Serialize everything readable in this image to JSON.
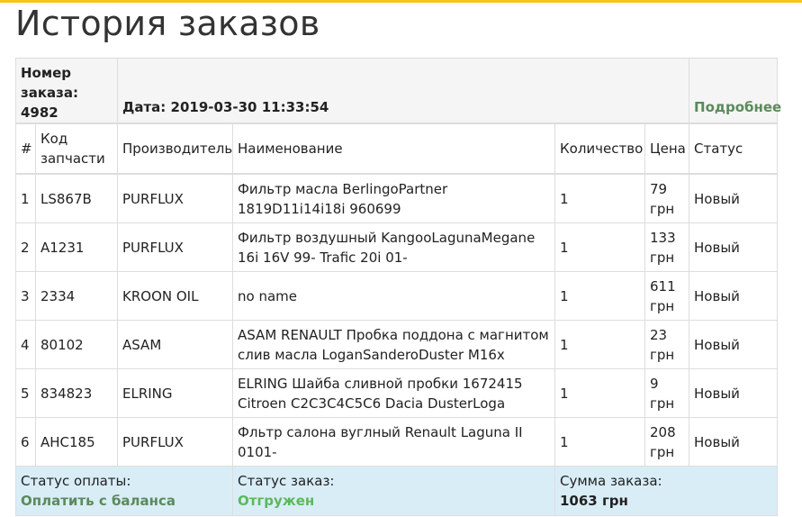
{
  "page_title": "История заказов",
  "order": {
    "number_label": "Номер заказа:",
    "number": "4982",
    "date_label": "Дата:",
    "date": "2019-03-30 11:33:54",
    "details_link": "Подробнее"
  },
  "columns": [
    "#",
    "Код запчасти",
    "Производитель",
    "Наименование",
    "Количество",
    "Цена",
    "Статус"
  ],
  "items": [
    {
      "n": "1",
      "code": "LS867B",
      "maker": "PURFLUX",
      "name": "Фильтр масла BerlingoPartner 1819D11i14i18i 960699",
      "qty": "1",
      "price": "79 грн",
      "status": "Новый"
    },
    {
      "n": "2",
      "code": "A1231",
      "maker": "PURFLUX",
      "name": "Фильтр воздушный KangooLagunaMegane 16i 16V 99- Trafic 20i 01-",
      "qty": "1",
      "price": "133 грн",
      "status": "Новый"
    },
    {
      "n": "3",
      "code": "2334",
      "maker": "KROON OIL",
      "name": "no name",
      "qty": "1",
      "price": "611 грн",
      "status": "Новый"
    },
    {
      "n": "4",
      "code": "80102",
      "maker": "ASAM",
      "name": "ASAM RENAULT Пробка поддона с магнитом слив масла LoganSanderoDuster M16x",
      "qty": "1",
      "price": "23 грн",
      "status": "Новый"
    },
    {
      "n": "5",
      "code": "834823",
      "maker": "ELRING",
      "name": "ELRING Шайба сливной пробки 1672415 Citroen C2C3C4C5C6 Dacia DusterLoga",
      "qty": "1",
      "price": "9 грн",
      "status": "Новый"
    },
    {
      "n": "6",
      "code": "AHC185",
      "maker": "PURFLUX",
      "name": "Фльтр салона вуглный Renault Laguna II 0101-",
      "qty": "1",
      "price": "208 грн",
      "status": "Новый"
    }
  ],
  "footer": {
    "payment_label": "Статус оплаты:",
    "payment_value": "Оплатить с баланса",
    "order_status_label": "Статус заказ:",
    "order_status_value": "Отгружен",
    "sum_label": "Сумма заказа:",
    "sum_value": "1063 грн"
  },
  "colors": {
    "accent_bar": "#f5c518",
    "link_green": "#5b8a5b",
    "status_green": "#5cb85c",
    "footer_bg": "#d9edf7"
  }
}
